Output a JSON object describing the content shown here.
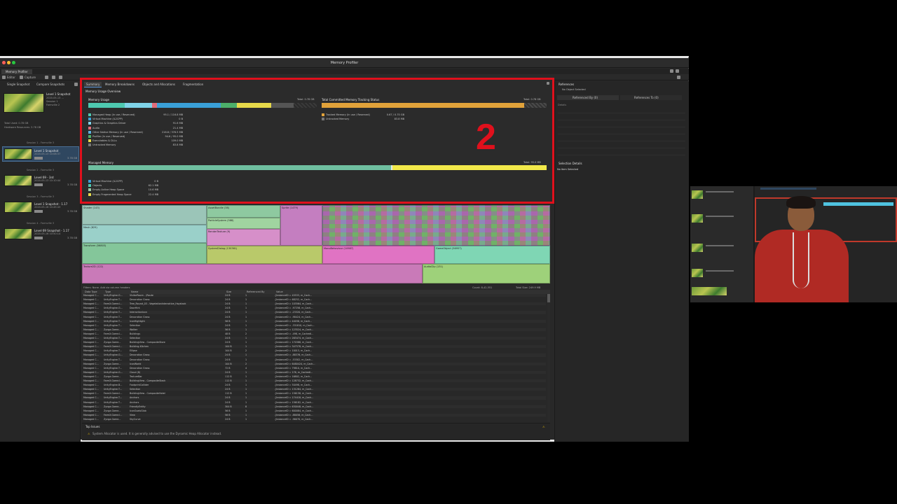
{
  "window": {
    "title": "Memory Profiler",
    "tab": "Memory Profiler",
    "toolbar": {
      "editor": "Editor",
      "capture": "Capture"
    }
  },
  "left_panel": {
    "tabs": [
      "Single Snapshot",
      "Compare Snapshots"
    ],
    "current": {
      "name": "Level 1 Snapshot",
      "date": "2020-05-13 ...",
      "session": "Session 1",
      "player": "Farmville 2",
      "total_used": "Total Used: 0.78 GB",
      "hardware": "Hardware Resources: 3.78 GB"
    },
    "sessions": [
      {
        "header": "Session 1 - Farmville 3",
        "snapshots": [
          {
            "name": "Level 1 Snapshot",
            "date": "2020-05-13 10:08:37",
            "size": "3.78 GB",
            "selected": true
          }
        ]
      },
      {
        "header": "Session 2 - Farmville 3",
        "snapshots": [
          {
            "name": "Level 69 - 3rd",
            "date": "2020-05-13 10:10:44",
            "size": "3.78 GB",
            "selected": false
          }
        ]
      },
      {
        "header": "Session 3 - Farmville 3",
        "snapshots": [
          {
            "name": "Level 1 Snapshot - 1.17",
            "date": "2020-05-16 10:45:43",
            "size": "3.78 GB",
            "selected": false
          }
        ]
      },
      {
        "header": "Session 4 - Farmville 3",
        "snapshots": [
          {
            "name": "Level 69 Snapshot - 1.17",
            "date": "2020-05-16 10:50:14",
            "size": "3.78 GB",
            "selected": false
          }
        ]
      }
    ]
  },
  "summary": {
    "tabs": [
      "Summary",
      "Memory Breakdowns",
      "Objects and Allocations",
      "Fragmentation"
    ],
    "active_tab": "Summary",
    "section_title": "Memory Usage Overview",
    "memory_usage": {
      "title": "Memory Usage",
      "total": "Total: 0.78 GB",
      "legend": [
        {
          "label": "Managed Heap",
          "sub": "(In use / Reserved)",
          "value": "95.1 / 116.8 MB",
          "color": "#4ec9b0"
        },
        {
          "label": "Virtual Machine (IL2CPP)",
          "sub": "",
          "value": "0 B",
          "color": "#3aa0d8"
        },
        {
          "label": "Graphics & Graphics Driver",
          "sub": "",
          "value": "91.6 MB",
          "color": "#7fd3e8"
        },
        {
          "label": "Audio",
          "sub": "",
          "value": "21.4 MB",
          "color": "#e06c7a"
        },
        {
          "label": "Other Native Memory",
          "sub": "(In use / Reserved)",
          "value": "216.8 / 376.5 MB",
          "color": "#5db1e0"
        },
        {
          "label": "Profiler",
          "sub": "(In use / Reserved)",
          "value": "94.6 / 95.0 MB",
          "color": "#4caf6a"
        },
        {
          "label": "Executables & DLLs",
          "sub": "",
          "value": "109.0 MB",
          "color": "#e6d94a"
        },
        {
          "label": "Untracked Memory",
          "sub": "",
          "value": "83.8 MB",
          "color": "#777777"
        }
      ],
      "bar_segments": [
        {
          "fraction": 0.16,
          "color": "#4ec9b0"
        },
        {
          "fraction": 0.12,
          "color": "#7fd3e8"
        },
        {
          "fraction": 0.02,
          "color": "#e06c7a"
        },
        {
          "fraction": 0.28,
          "color": "#3aa0d8"
        },
        {
          "fraction": 0.07,
          "color": "#4caf6a"
        },
        {
          "fraction": 0.15,
          "color": "#e6d94a"
        },
        {
          "fraction": 0.1,
          "color": "#555555"
        }
      ]
    },
    "tracking": {
      "title": "Total Committed Memory Tracking Status",
      "total": "Total: 0.78 GB",
      "legend": [
        {
          "label": "Tracked Memory",
          "sub": "(In use / Reserved)",
          "value": "0.67 / 0.70 GB",
          "color": "#e1a23a"
        },
        {
          "label": "Untracked Memory",
          "sub": "",
          "value": "83.8 MB",
          "color": "#777777"
        }
      ],
      "tracked_fraction": 0.9
    },
    "managed": {
      "title": "Managed Memory",
      "total": "Total: 95.0 MB",
      "legend": [
        {
          "label": "Virtual Machine (IL2CPP)",
          "value": "0 B",
          "color": "#3aa0d8"
        },
        {
          "label": "Objects",
          "value": "62.1 MB",
          "color": "#4ec9b0"
        },
        {
          "label": "Empty Active Heap Space",
          "value": "10.6 MB",
          "color": "#9acbaa"
        },
        {
          "label": "Empty Fragmented Heap Space",
          "value": "22.4 MB",
          "color": "#e6d94a"
        }
      ],
      "objects_fraction": 0.66
    },
    "annotation": "2"
  },
  "treemap": {
    "cells": [
      {
        "label": "Shader (143)",
        "color": "#9bc5b8"
      },
      {
        "label": "AssetBundle (38)",
        "color": "#8ec9a0"
      },
      {
        "label": "Mesh (829)",
        "color": "#9ad0c9"
      },
      {
        "label": "ParticleSystem (588)",
        "color": "#a0d4a0"
      },
      {
        "label": "RenderTexture (9)",
        "color": "#d68fc9"
      },
      {
        "label": "Sprite (1479)",
        "color": "#c47ec0"
      },
      {
        "label": "Transform (56803)",
        "color": "#84c69a"
      },
      {
        "label": "SystemDialog (130361)",
        "color": "#b9c96a"
      },
      {
        "label": "MonoBehaviour (10987)",
        "color": "#e073c3"
      },
      {
        "label": "GameObject (56957)",
        "color": "#7fd6b4"
      },
      {
        "label": "Texture2D (122)",
        "color": "#c97ab8"
      },
      {
        "label": "AudioClip (131)",
        "color": "#9ed17a"
      }
    ]
  },
  "table": {
    "filter_label": "Filters: None. Add via column headers",
    "count": "Count: 8,42,551",
    "total_size": "Total Size: 249.9 MB",
    "columns": [
      "Data Type",
      "Type",
      "Name",
      "Size",
      "Referenced By",
      "Value"
    ],
    "rows": [
      [
        "Managed C...",
        "UnityEngine.G...",
        "VisitorRoom - (Route",
        "24 B",
        "1",
        "{InstanceID = 45533, m_Cach..."
      ],
      [
        "Managed C...",
        "UnityEngine.T...",
        "Decoration Grass",
        "24 B",
        "1",
        "{InstanceID = 68252, m_Cach..."
      ],
      [
        "Managed C...",
        "FarmX.Game.I...",
        "Tree_Round_03 - VegetationInteractive_Haystack",
        "24 B",
        "1",
        "{InstanceID = 103564, m_Cach..."
      ],
      [
        "Managed C...",
        "UnityEngine.G...",
        "DoorHint",
        "24 B",
        "1",
        "{InstanceID = -97256, m_Cach..."
      ],
      [
        "Managed C...",
        "UnityEngine.T...",
        "InteractionIcon",
        "24 B",
        "1",
        "{InstanceID = -23320, m_Cach..."
      ],
      [
        "Managed C...",
        "UnityEngine.T...",
        "Decoration Grass",
        "24 B",
        "1",
        "{InstanceID = -98424, m_Cach..."
      ],
      [
        "Managed C...",
        "UnityEngine.T...",
        "IconHighlight",
        "56 B",
        "1",
        "{InstanceID = 44038, m_Cach..."
      ],
      [
        "Managed C...",
        "UnityEngine.T...",
        "Selection",
        "24 B",
        "1",
        "{InstanceID = -331810, m_Cach..."
      ],
      [
        "Managed C...",
        "Zynga.Game...",
        "Walker",
        "56 B",
        "1",
        "{InstanceID = 123524, m_Cach..."
      ],
      [
        "Managed C...",
        "FarmX.Game.I...",
        "Buildings",
        "48 B",
        "2",
        "{InstanceID = -498, m_CachedI..."
      ],
      [
        "Managed C...",
        "UnityEngine.T...",
        "Selection",
        "24 B",
        "1",
        "{InstanceID = 263474, m_Cach..."
      ],
      [
        "Managed C...",
        "Zynga.Game...",
        "BuildingView - CompositeStore",
        "24 B",
        "1",
        "{InstanceID = 170388, m_Cach..."
      ],
      [
        "Managed C...",
        "FarmX.Game.I...",
        "Building-Kitchen",
        "104 B",
        "1",
        "{InstanceID = 347578, m_Cach..."
      ],
      [
        "Managed C...",
        "UnityEngine.T...",
        "Ellipse",
        "104 B",
        "2",
        "{InstanceID = 10013, m_Cach..."
      ],
      [
        "Managed C...",
        "UnityEngine.G...",
        "Decoration Grass",
        "24 B",
        "1",
        "{InstanceID = -88376, m_Cach..."
      ],
      [
        "Managed C...",
        "UnityEngine.T...",
        "Decoration Grass",
        "24 B",
        "1",
        "{InstanceID = -53302, m_Cach..."
      ],
      [
        "Managed C...",
        "Zynga.Game...",
        "IconWorld",
        "104 B",
        "2",
        "{InstanceID = 6480424, m_Cach..."
      ],
      [
        "Managed C...",
        "UnityEngine.T...",
        "Decoration Grass",
        "72 B",
        "4",
        "{InstanceID = 79810, m_Cach..."
      ],
      [
        "Managed C...",
        "UnityEngine.G...",
        "Cloud (8)",
        "24 B",
        "1",
        "{InstanceID = 176, m_CachedI..."
      ],
      [
        "Managed C...",
        "Zynga.Game...",
        "TextureBar",
        "112 B",
        "1",
        "{InstanceID = 16802, m_Cach..."
      ],
      [
        "Managed C...",
        "FarmX.Game.I...",
        "BuildingView - CompositeStack",
        "112 B",
        "1",
        "{InstanceID = 128732, m_Cach..."
      ],
      [
        "Managed C...",
        "UnityEngine.B...",
        "FootprintCollider",
        "24 B",
        "1",
        "{InstanceID = 50498, m_Cach..."
      ],
      [
        "Managed C...",
        "UnityEngine.T...",
        "Selection",
        "24 B",
        "1",
        "{InstanceID = 131264, m_Cach..."
      ],
      [
        "Managed C...",
        "FarmX.Game.I...",
        "BuildingView - CompositeHotel",
        "112 B",
        "1",
        "{InstanceID = 156158, m_Cach..."
      ],
      [
        "Managed C...",
        "UnityEngine.T...",
        "Anchors",
        "24 B",
        "1",
        "{InstanceID = 174418, m_Cach..."
      ],
      [
        "Managed C...",
        "UnityEngine.T...",
        "Anchors",
        "24 B",
        "1",
        "{InstanceID = 156182, m_Cach..."
      ],
      [
        "Managed C...",
        "Zynga.Game...",
        "FriendlyEntity",
        "304 B",
        "8",
        "{InstanceID = 630048, m_Cach..."
      ],
      [
        "Managed C...",
        "Zynga.Game...",
        "IconGoalsGlob",
        "56 B",
        "1",
        "{InstanceID = 600084, m_Cach..."
      ],
      [
        "Managed C...",
        "FarmX.Game.I...",
        "View",
        "56 B",
        "1",
        "{InstanceID = -88056, m_Cach..."
      ],
      [
        "Managed C...",
        "Zynga.Game...",
        "SkyCurve",
        "24 B",
        "1",
        "{InstanceID = -96070, m_Cach..."
      ]
    ]
  },
  "top_issues": {
    "title": "Top Issues",
    "message": "System Allocator is used. It is generally advised to use the Dynamic Heap Allocator instead."
  },
  "right_panel": {
    "title": "References",
    "no_object": "No Object Selected",
    "tabs": [
      "Referenced By (0)",
      "References To (0)"
    ],
    "details": "Details",
    "selection_details": "Selection Details",
    "no_item": "No Item Selected"
  }
}
